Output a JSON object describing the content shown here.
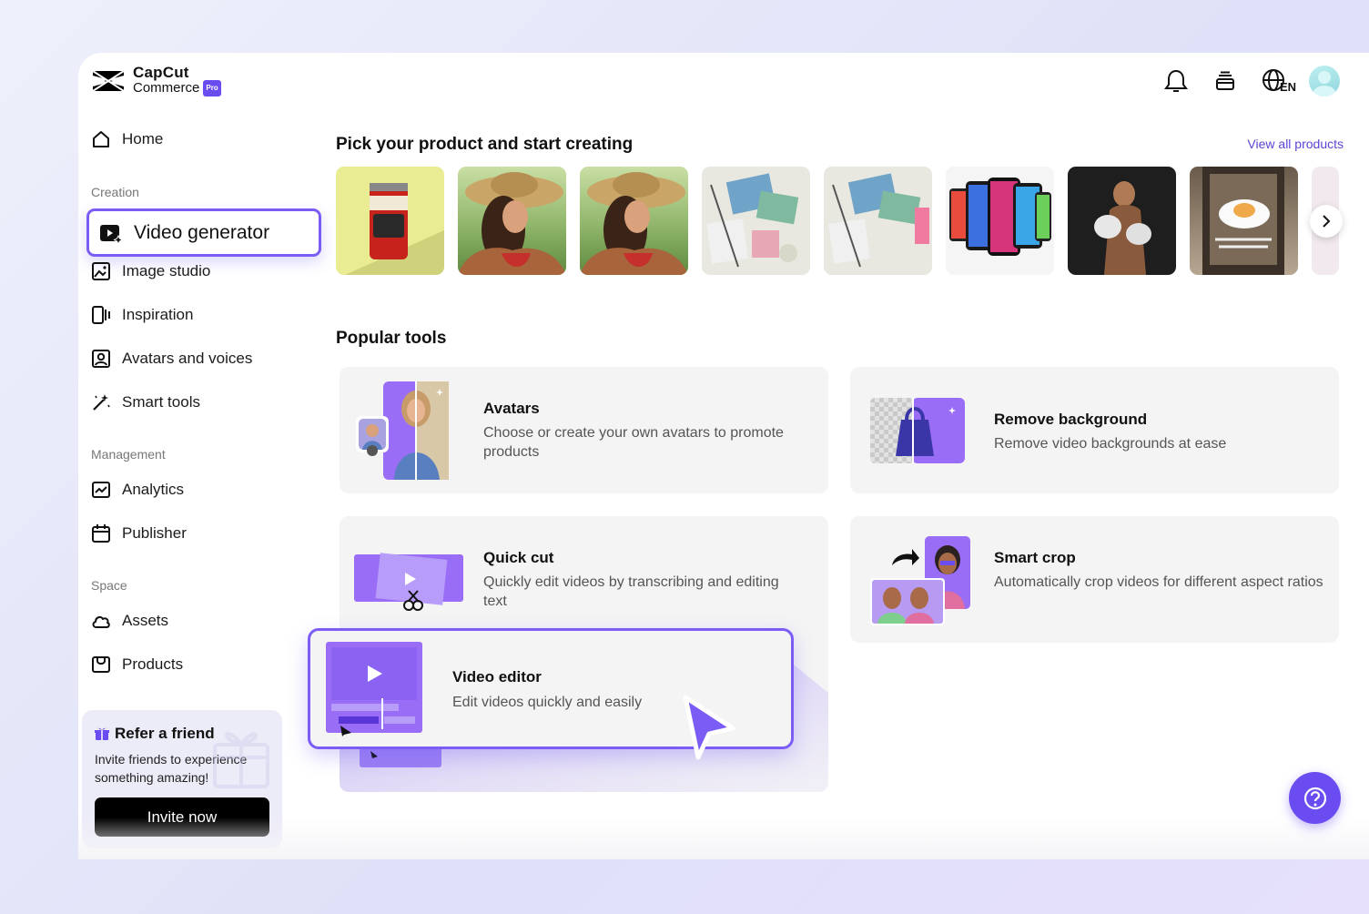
{
  "brand": {
    "line1": "CapCut",
    "line2": "Commerce",
    "badge": "Pro"
  },
  "header": {
    "language": "EN"
  },
  "sidebar": {
    "home": "Home",
    "sections": {
      "creation": "Creation",
      "management": "Management",
      "space": "Space"
    },
    "items": {
      "video_generator": "Video generator",
      "image_studio": "Image studio",
      "inspiration": "Inspiration",
      "avatars_voices": "Avatars and voices",
      "smart_tools": "Smart tools",
      "analytics": "Analytics",
      "publisher": "Publisher",
      "assets": "Assets",
      "products": "Products"
    },
    "refer": {
      "title": "Refer a friend",
      "text": "Invite friends to experience something amazing!",
      "button": "Invite now"
    }
  },
  "main": {
    "pick_heading": "Pick your product and start creating",
    "view_all": "View all products",
    "products": [
      {
        "name": "can-product"
      },
      {
        "name": "woman-hat-product"
      },
      {
        "name": "woman-hat-product-2"
      },
      {
        "name": "stationery-flatlay-product"
      },
      {
        "name": "stationery-flatlay-product-2"
      },
      {
        "name": "smartphones-product"
      },
      {
        "name": "boxer-product"
      },
      {
        "name": "table-setting-product"
      },
      {
        "name": "partial-product"
      }
    ],
    "popular_heading": "Popular tools",
    "tools": {
      "avatars": {
        "title": "Avatars",
        "desc": "Choose or create your own avatars to promote products"
      },
      "remove_bg": {
        "title": "Remove background",
        "desc": "Remove video backgrounds at ease"
      },
      "quick_cut": {
        "title": "Quick cut",
        "desc": "Quickly edit videos by transcribing and editing text"
      },
      "smart_crop": {
        "title": "Smart crop",
        "desc": "Automatically crop videos for different aspect ratios"
      },
      "video_editor": {
        "title": "Video editor",
        "desc": "Edit videos quickly and easily"
      }
    }
  },
  "colors": {
    "accent": "#6a4cf0",
    "highlight_border": "#7b5cf5",
    "link": "#5b45d6"
  }
}
